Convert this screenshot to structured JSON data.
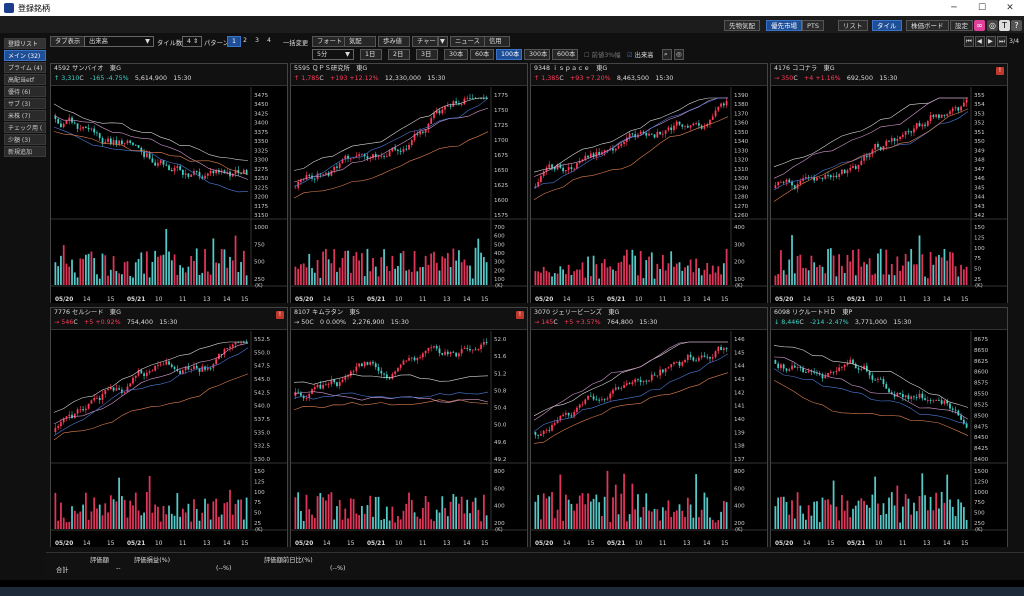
{
  "window": {
    "title": "登録銘柄"
  },
  "topbar": {
    "buttons": [
      "先物気配",
      "優先市場",
      "PTS",
      "リスト",
      "タイル",
      "株価ボード",
      "設定"
    ],
    "active": [
      "優先市場",
      "タイル"
    ]
  },
  "toolbar": {
    "tab_display_label": "タブ表示",
    "sort_select": "出来高",
    "tile_count_label": "タイル数",
    "tile_count": "4",
    "pattern_label": "パターン",
    "patterns": [
      "1",
      "2",
      "3",
      "4"
    ],
    "batch_change_label": "一括変更",
    "buttons": [
      "フォート",
      "気配",
      "歩み値",
      "チャート",
      "ニュース",
      "信用"
    ],
    "interval": "5分",
    "spans": [
      "1日",
      "2日",
      "3日",
      "30本",
      "60本",
      "100本",
      "300本",
      "600本"
    ],
    "active_span": "100本",
    "checks": [
      {
        "label": "前値3%幅",
        "checked": false
      },
      {
        "label": "出来高",
        "checked": true
      }
    ],
    "page": "3/4"
  },
  "sidebar": {
    "items": [
      "登録リスト",
      "メイン (32)",
      "プライム (4)",
      "高配当etf",
      "優待 (6)",
      "サブ (3)",
      "米株 (7)",
      "チェック用 (",
      "少額 (3)",
      "新規追加"
    ],
    "active": 1
  },
  "tiles": [
    {
      "code": "4592",
      "name": "サンバイオ",
      "market": "東G",
      "arrow": "↑",
      "price": "3,310",
      "mark": "C",
      "change": "-165",
      "pct": "-4.75%",
      "volume": "5,614,900",
      "time": "15:30",
      "dir": "dn",
      "warn": false,
      "yticks": [
        "3475",
        "3450",
        "3425",
        "3400",
        "3375",
        "3350",
        "3325",
        "3300",
        "3275",
        "3250",
        "3225",
        "3200",
        "3175",
        "3150"
      ],
      "vticks": [
        "1000",
        "750",
        "500",
        "250"
      ],
      "xlabels": [
        "05/20",
        "14",
        "15",
        "05/21",
        "10",
        "11",
        "13",
        "14",
        "15"
      ],
      "unit": "(K)"
    },
    {
      "code": "5595",
      "name": "ＱＰＳ研究所",
      "market": "東G",
      "arrow": "↑",
      "price": "1,785",
      "mark": "C",
      "change": "+193",
      "pct": "+12.12%",
      "volume": "12,330,000",
      "time": "15:30",
      "dir": "up",
      "warn": false,
      "yticks": [
        "1775",
        "1750",
        "1725",
        "1700",
        "1675",
        "1650",
        "1625",
        "1600",
        "1575"
      ],
      "vticks": [
        "700",
        "600",
        "500",
        "400",
        "300",
        "200",
        "100"
      ],
      "xlabels": [
        "05/20",
        "14",
        "15",
        "05/21",
        "10",
        "11",
        "13",
        "14",
        "15"
      ],
      "unit": "(K)"
    },
    {
      "code": "9348",
      "name": "ｉｓｐａｃｅ",
      "market": "東G",
      "arrow": "↑",
      "price": "1,385",
      "mark": "C",
      "change": "+93",
      "pct": "+7.20%",
      "volume": "8,463,500",
      "time": "15:30",
      "dir": "up",
      "warn": false,
      "yticks": [
        "1390",
        "1380",
        "1370",
        "1360",
        "1350",
        "1340",
        "1330",
        "1320",
        "1310",
        "1300",
        "1290",
        "1280",
        "1270",
        "1260"
      ],
      "vticks": [
        "400",
        "300",
        "200",
        "100"
      ],
      "xlabels": [
        "05/20",
        "14",
        "15",
        "05/21",
        "10",
        "11",
        "13",
        "14",
        "15"
      ],
      "unit": "(K)"
    },
    {
      "code": "4176",
      "name": "ココナラ",
      "market": "東G",
      "arrow": "→",
      "price": "350",
      "mark": "C",
      "change": "+4",
      "pct": "+1.16%",
      "volume": "692,500",
      "time": "15:30",
      "dir": "up",
      "warn": true,
      "yticks": [
        "355",
        "354",
        "353",
        "352",
        "351",
        "350",
        "349",
        "348",
        "347",
        "346",
        "345",
        "344",
        "343",
        "342"
      ],
      "vticks": [
        "150",
        "125",
        "100",
        "75",
        "50",
        "25"
      ],
      "xlabels": [
        "05/20",
        "14",
        "15",
        "05/21",
        "10",
        "11",
        "13",
        "14",
        "15"
      ],
      "unit": "(K)"
    },
    {
      "code": "7776",
      "name": "セルシード",
      "market": "東G",
      "arrow": "→",
      "price": "546",
      "mark": "C",
      "change": "+5",
      "pct": "+0.92%",
      "volume": "754,400",
      "time": "15:30",
      "dir": "up",
      "warn": true,
      "yticks": [
        "552.5",
        "550.0",
        "547.5",
        "545.0",
        "542.5",
        "540.0",
        "537.5",
        "535.0",
        "532.5",
        "530.0"
      ],
      "vticks": [
        "150",
        "125",
        "100",
        "75",
        "50",
        "25"
      ],
      "xlabels": [
        "05/20",
        "14",
        "15",
        "05/21",
        "10",
        "11",
        "13",
        "14",
        "15"
      ],
      "unit": "(K)"
    },
    {
      "code": "8107",
      "name": "キムラタン",
      "market": "東S",
      "arrow": "→",
      "price": "50",
      "mark": "C",
      "change": "0",
      "pct": "0.00%",
      "volume": "2,276,900",
      "time": "15:30",
      "dir": "fl",
      "warn": true,
      "yticks": [
        "52.0",
        "51.6",
        "51.2",
        "50.8",
        "50.4",
        "50.0",
        "49.6",
        "49.2"
      ],
      "vticks": [
        "800",
        "600",
        "400",
        "200"
      ],
      "xlabels": [
        "05/20",
        "14",
        "15",
        "05/21",
        "10",
        "11",
        "13",
        "14",
        "15"
      ],
      "unit": "(K)"
    },
    {
      "code": "3070",
      "name": "ジェリービーンズ",
      "market": "東G",
      "arrow": "→",
      "price": "145",
      "mark": "C",
      "change": "+5",
      "pct": "+3.57%",
      "volume": "764,800",
      "time": "15:30",
      "dir": "up",
      "warn": false,
      "yticks": [
        "146",
        "145",
        "144",
        "143",
        "142",
        "141",
        "140",
        "139",
        "138",
        "137"
      ],
      "vticks": [
        "800",
        "600",
        "400",
        "200"
      ],
      "xlabels": [
        "05/20",
        "14",
        "15",
        "05/21",
        "10",
        "11",
        "13",
        "14",
        "15"
      ],
      "unit": "(K)"
    },
    {
      "code": "6098",
      "name": "リクルートＨＤ",
      "market": "東P",
      "arrow": "↓",
      "price": "8,446",
      "mark": "C",
      "change": "-214",
      "pct": "-2.47%",
      "volume": "3,771,000",
      "time": "15:30",
      "dir": "dn",
      "warn": false,
      "yticks": [
        "8675",
        "8650",
        "8625",
        "8600",
        "8575",
        "8550",
        "8525",
        "8500",
        "8475",
        "8450",
        "8425",
        "8400"
      ],
      "vticks": [
        "1500",
        "1250",
        "1000",
        "750",
        "500",
        "250"
      ],
      "xlabels": [
        "05/20",
        "14",
        "15",
        "05/21",
        "10",
        "11",
        "13",
        "14",
        "15"
      ],
      "unit": "(K)"
    }
  ],
  "bottom": {
    "total_label": "合計",
    "cols": [
      "評価額",
      "評価損益(%)",
      "評価額前日比(%)"
    ],
    "vals": [
      "--",
      "(--%)",
      "(--%)"
    ]
  }
}
